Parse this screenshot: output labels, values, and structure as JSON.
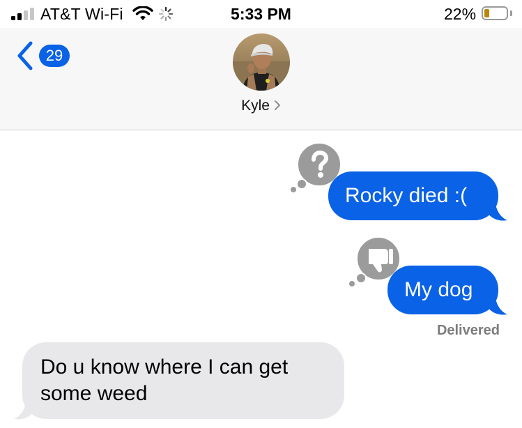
{
  "status_bar": {
    "carrier": "AT&T Wi-Fi",
    "time": "5:33 PM",
    "battery_percent": "22%",
    "battery_level": 0.22,
    "battery_color": "#b8860b"
  },
  "header": {
    "back_count": "29",
    "contact_name": "Kyle",
    "accent_color": "#0a62e6"
  },
  "messages": [
    {
      "direction": "sent",
      "text": "Rocky died :(",
      "reaction": "question-mark"
    },
    {
      "direction": "sent",
      "text": "My dog",
      "reaction": "thumbs-down"
    },
    {
      "direction": "received",
      "text": "Do u know where I can get some weed",
      "reaction": null
    }
  ],
  "delivery_status": "Delivered"
}
